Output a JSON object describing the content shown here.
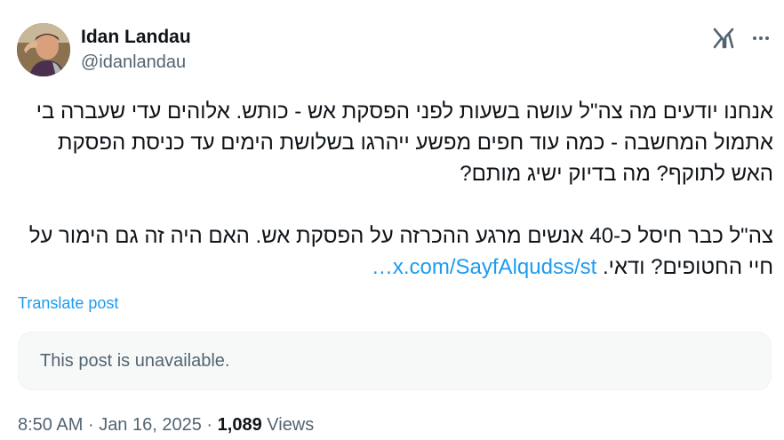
{
  "author": {
    "display_name": "Idan Landau",
    "handle": "@idanlandau"
  },
  "header_icons": {
    "brand_icon": "x-grok-icon",
    "menu_icon": "more-icon"
  },
  "post": {
    "paragraph_1": "אנחנו יודעים מה צה\"ל עושה בשעות לפני הפסקת אש - כותש. אלוהים עדי שעברה בי אתמול המחשבה - כמה עוד חפים מפשע ייהרגו בשלושת הימים עד כניסת הפסקת האש לתוקף? מה בדיוק ישיג מותם?",
    "paragraph_2": "צה\"ל כבר חיסל כ-40 אנשים מרגע ההכרזה על הפסקת אש. האם היה זה גם הימור על חיי החטופים? ודאי.",
    "link_text": "x.com/SayfAlqudss/st…"
  },
  "translate_label": "Translate post",
  "quoted_post": {
    "message": "This post is unavailable."
  },
  "meta": {
    "time": "8:50 AM",
    "separator": "·",
    "date": "Jan 16, 2025",
    "views_count": "1,089",
    "views_label": "Views"
  },
  "colors": {
    "text": "#0f1419",
    "secondary": "#536471",
    "link": "#1d9bf0",
    "card_bg": "#f7f9f9"
  }
}
